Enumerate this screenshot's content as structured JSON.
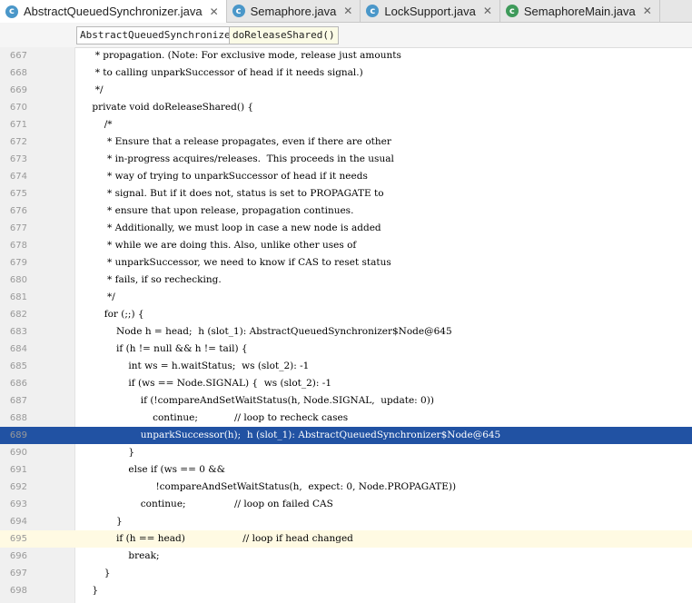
{
  "tabs": [
    {
      "label": "AbstractQueuedSynchronizer.java",
      "active": true,
      "icon": "class-icon"
    },
    {
      "label": "Semaphore.java",
      "active": false,
      "icon": "class-icon"
    },
    {
      "label": "LockSupport.java",
      "active": false,
      "icon": "class-icon"
    },
    {
      "label": "SemaphoreMain.java",
      "active": false,
      "icon": "run-class-icon"
    }
  ],
  "breadcrumbs": [
    "AbstractQueuedSynchronizer",
    "doReleaseShared()"
  ],
  "lines": [
    {
      "n": "667",
      "t": "     * propagation. (Note: For exclusive mode, release just amounts"
    },
    {
      "n": "668",
      "t": "     * to calling unparkSuccessor of head if it needs signal.)"
    },
    {
      "n": "669",
      "t": "     */"
    },
    {
      "n": "670",
      "t": "    private void doReleaseShared() {"
    },
    {
      "n": "671",
      "t": "        /*"
    },
    {
      "n": "672",
      "t": "         * Ensure that a release propagates, even if there are other"
    },
    {
      "n": "673",
      "t": "         * in-progress acquires/releases.  This proceeds in the usual"
    },
    {
      "n": "674",
      "t": "         * way of trying to unparkSuccessor of head if it needs"
    },
    {
      "n": "675",
      "t": "         * signal. But if it does not, status is set to PROPAGATE to"
    },
    {
      "n": "676",
      "t": "         * ensure that upon release, propagation continues."
    },
    {
      "n": "677",
      "t": "         * Additionally, we must loop in case a new node is added"
    },
    {
      "n": "678",
      "t": "         * while we are doing this. Also, unlike other uses of"
    },
    {
      "n": "679",
      "t": "         * unparkSuccessor, we need to know if CAS to reset status"
    },
    {
      "n": "680",
      "t": "         * fails, if so rechecking."
    },
    {
      "n": "681",
      "t": "         */"
    },
    {
      "n": "682",
      "t": "        for (;;) {"
    },
    {
      "n": "683",
      "t": "            Node h = head;  h (slot_1): AbstractQueuedSynchronizer$Node@645"
    },
    {
      "n": "684",
      "t": "            if (h != null && h != tail) {"
    },
    {
      "n": "685",
      "t": "                int ws = h.waitStatus;  ws (slot_2): -1"
    },
    {
      "n": "686",
      "t": "                if (ws == Node.SIGNAL) {  ws (slot_2): -1"
    },
    {
      "n": "687",
      "t": "                    if (!compareAndSetWaitStatus(h, Node.SIGNAL,  update: 0))"
    },
    {
      "n": "688",
      "t": "                        continue;            // loop to recheck cases"
    },
    {
      "n": "689",
      "t": "                    unparkSuccessor(h);  h (slot_1): AbstractQueuedSynchronizer$Node@645"
    },
    {
      "n": "690",
      "t": "                }"
    },
    {
      "n": "691",
      "t": "                else if (ws == 0 &&"
    },
    {
      "n": "692",
      "t": "                         !compareAndSetWaitStatus(h,  expect: 0, Node.PROPAGATE))"
    },
    {
      "n": "693",
      "t": "                    continue;                // loop on failed CAS"
    },
    {
      "n": "694",
      "t": "            }"
    },
    {
      "n": "695",
      "t": "            if (h == head)                   // loop if head changed"
    },
    {
      "n": "696",
      "t": "                break;"
    },
    {
      "n": "697",
      "t": "        }"
    },
    {
      "n": "698",
      "t": "    }"
    }
  ]
}
